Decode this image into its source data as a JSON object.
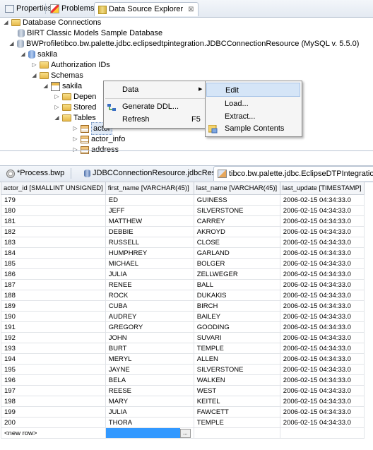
{
  "top_tabs": [
    {
      "label": "Properties",
      "icon": "properties-icon"
    },
    {
      "label": "Problems",
      "icon": "problems-icon"
    },
    {
      "label": "Data Source Explorer",
      "icon": "data-source-explorer-icon",
      "close": "⊠"
    }
  ],
  "tree": {
    "root": "Database Connections",
    "birt": "BIRT Classic Models Sample Database",
    "connection": "BWProfiletibco.bw.palette.jdbc.eclipsedtpintegration.JDBCConnectionResource (MySQL v. 5.5.0)",
    "db": "sakila",
    "auth": "Authorization IDs",
    "schemas": "Schemas",
    "schema": "sakila",
    "dependencies": "Depen",
    "stored": "Stored",
    "tables": "Tables",
    "table_actor": "actor",
    "table_actor_info": "actor_info",
    "table_address": "address"
  },
  "context_menu": {
    "items": [
      {
        "label": "Data",
        "submenu": "▶"
      },
      {
        "label": "Generate DDL..."
      },
      {
        "label": "Refresh",
        "shortcut": "F5"
      }
    ],
    "submenu_items": [
      {
        "label": "Edit"
      },
      {
        "label": "Load..."
      },
      {
        "label": "Extract..."
      },
      {
        "label": "Sample Contents"
      }
    ]
  },
  "editor_tabs": [
    {
      "label": "*Process.bwp"
    },
    {
      "label": "JDBCConnectionResource.jdbcResource"
    },
    {
      "label": "tibco.bw.palette.jdbc.EclipseDTPIntegration"
    }
  ],
  "grid": {
    "columns": [
      "actor_id [SMALLINT UNSIGNED]",
      "first_name [VARCHAR(45)]",
      "last_name [VARCHAR(45)]",
      "last_update [TIMESTAMP]"
    ],
    "rows": [
      [
        "179",
        "ED",
        "GUINESS",
        "2006-02-15 04:34:33.0"
      ],
      [
        "180",
        "JEFF",
        "SILVERSTONE",
        "2006-02-15 04:34:33.0"
      ],
      [
        "181",
        "MATTHEW",
        "CARREY",
        "2006-02-15 04:34:33.0"
      ],
      [
        "182",
        "DEBBIE",
        "AKROYD",
        "2006-02-15 04:34:33.0"
      ],
      [
        "183",
        "RUSSELL",
        "CLOSE",
        "2006-02-15 04:34:33.0"
      ],
      [
        "184",
        "HUMPHREY",
        "GARLAND",
        "2006-02-15 04:34:33.0"
      ],
      [
        "185",
        "MICHAEL",
        "BOLGER",
        "2006-02-15 04:34:33.0"
      ],
      [
        "186",
        "JULIA",
        "ZELLWEGER",
        "2006-02-15 04:34:33.0"
      ],
      [
        "187",
        "RENEE",
        "BALL",
        "2006-02-15 04:34:33.0"
      ],
      [
        "188",
        "ROCK",
        "DUKAKIS",
        "2006-02-15 04:34:33.0"
      ],
      [
        "189",
        "CUBA",
        "BIRCH",
        "2006-02-15 04:34:33.0"
      ],
      [
        "190",
        "AUDREY",
        "BAILEY",
        "2006-02-15 04:34:33.0"
      ],
      [
        "191",
        "GREGORY",
        "GOODING",
        "2006-02-15 04:34:33.0"
      ],
      [
        "192",
        "JOHN",
        "SUVARI",
        "2006-02-15 04:34:33.0"
      ],
      [
        "193",
        "BURT",
        "TEMPLE",
        "2006-02-15 04:34:33.0"
      ],
      [
        "194",
        "MERYL",
        "ALLEN",
        "2006-02-15 04:34:33.0"
      ],
      [
        "195",
        "JAYNE",
        "SILVERSTONE",
        "2006-02-15 04:34:33.0"
      ],
      [
        "196",
        "BELA",
        "WALKEN",
        "2006-02-15 04:34:33.0"
      ],
      [
        "197",
        "REESE",
        "WEST",
        "2006-02-15 04:34:33.0"
      ],
      [
        "198",
        "MARY",
        "KEITEL",
        "2006-02-15 04:34:33.0"
      ],
      [
        "199",
        "JULIA",
        "FAWCETT",
        "2006-02-15 04:34:33.0"
      ],
      [
        "200",
        "THORA",
        "TEMPLE",
        "2006-02-15 04:34:33.0"
      ]
    ],
    "new_row": "<new row>",
    "browse_button": "..."
  }
}
